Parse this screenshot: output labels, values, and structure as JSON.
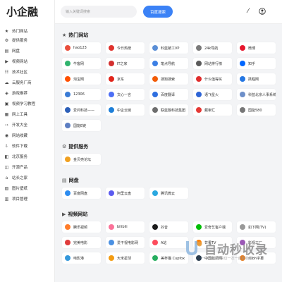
{
  "app": {
    "logo": "小企融"
  },
  "sidebar": {
    "items": [
      {
        "label": "热门网站",
        "icon": "star-icon",
        "glyph": "★"
      },
      {
        "label": "提供服务",
        "icon": "settings-icon",
        "glyph": "⚙"
      },
      {
        "label": "网盘",
        "icon": "drive-icon",
        "glyph": "▤"
      },
      {
        "label": "视频网站",
        "icon": "video-icon",
        "glyph": "▶"
      },
      {
        "label": "技术社区",
        "icon": "community-icon",
        "glyph": "☷"
      },
      {
        "label": "云服务厂商",
        "icon": "cloud-icon",
        "glyph": "☁"
      },
      {
        "label": "游戏推荐",
        "icon": "gamepad-icon",
        "glyph": "◈"
      },
      {
        "label": "视频学习教程",
        "icon": "film-icon",
        "glyph": "▣"
      },
      {
        "label": "网上工具",
        "icon": "tool-icon",
        "glyph": "▦"
      },
      {
        "label": "开发大全",
        "icon": "code-icon",
        "glyph": "‹›"
      },
      {
        "label": "网站收藏",
        "icon": "bookmark-icon",
        "glyph": "◉"
      },
      {
        "label": "软件下载",
        "icon": "download-icon",
        "glyph": "⇩"
      },
      {
        "label": "北京服务",
        "icon": "service-icon",
        "glyph": "◧"
      },
      {
        "label": "开源产品",
        "icon": "package-icon",
        "glyph": "◫"
      },
      {
        "label": "站长之家",
        "icon": "home-icon",
        "glyph": "⌂"
      },
      {
        "label": "图片壁纸",
        "icon": "image-icon",
        "glyph": "▧"
      },
      {
        "label": "项目管理",
        "icon": "project-icon",
        "glyph": "▥"
      }
    ]
  },
  "header": {
    "search_placeholder": "输入关键词搜索",
    "search_button": "百度搜索",
    "theme_icon": "magic-wand-icon",
    "user_icon": "user-icon"
  },
  "sections": [
    {
      "title": "热门网站",
      "icon": "star-icon",
      "glyph": "★",
      "tiles": [
        {
          "label": "hao123",
          "color": "#e94e3c"
        },
        {
          "label": "今日热榜",
          "color": "#e0322d"
        },
        {
          "label": "科蓝破工VP",
          "color": "#5b8fd6"
        },
        {
          "label": "24k导航",
          "color": "#7a7a7a"
        },
        {
          "label": "微博",
          "color": "#e6162d"
        },
        {
          "label": "牛客网",
          "color": "#2fb36d"
        },
        {
          "label": "IT之家",
          "color": "#d32f2f"
        },
        {
          "label": "笔点导航",
          "color": "#3c7fe4"
        },
        {
          "label": "网站排行榜",
          "color": "#5a5a5a"
        },
        {
          "label": "知乎",
          "color": "#0066ff"
        },
        {
          "label": "淘宝网",
          "color": "#ff5000"
        },
        {
          "label": "京东",
          "color": "#e1251b"
        },
        {
          "label": "搜狗搜索",
          "color": "#f25c05"
        },
        {
          "label": "什么值得买",
          "color": "#e02d2d"
        },
        {
          "label": "携程网",
          "color": "#2577e3"
        },
        {
          "label": "12306",
          "color": "#3a7bd5"
        },
        {
          "label": "文心一言",
          "color": "#4c6ef5"
        },
        {
          "label": "百度翻译",
          "color": "#2f6fe0"
        },
        {
          "label": "语飞星火",
          "color": "#2d64d6"
        },
        {
          "label": "科蓝北京人事系统",
          "color": "#6d8fc9"
        },
        {
          "label": "爱问科技——",
          "color": "#2c5fb8"
        },
        {
          "label": "中企云链",
          "color": "#1e7fd8"
        },
        {
          "label": "联蓝融科技集团",
          "color": "#6e6e6e"
        },
        {
          "label": "藏审汇",
          "color": "#e53935"
        },
        {
          "label": "国能580",
          "color": "#777777"
        },
        {
          "label": "国能E链",
          "color": "#5d7ec2"
        }
      ]
    },
    {
      "title": "提供服务",
      "icon": "settings-icon",
      "glyph": "⚙",
      "tiles": [
        {
          "label": "金贝壳论坛",
          "color": "#f0a020"
        }
      ]
    },
    {
      "title": "网盘",
      "icon": "drive-icon",
      "glyph": "▤",
      "tiles": [
        {
          "label": "百度网盘",
          "color": "#2d8cf0"
        },
        {
          "label": "阿里云盘",
          "color": "#5b5bf0"
        },
        {
          "label": "腾讯微云",
          "color": "#2aa8e0"
        }
      ]
    },
    {
      "title": "视频网站",
      "icon": "video-icon",
      "glyph": "▶",
      "tiles": [
        {
          "label": "腾讯视频",
          "color": "#ff7c2a"
        },
        {
          "label": "bilibili",
          "color": "#fb7299"
        },
        {
          "label": "抖音",
          "color": "#1c1c1c"
        },
        {
          "label": "爱奇艺客户端",
          "color": "#00be06"
        },
        {
          "label": "如下网(TV)",
          "color": "#999999"
        },
        {
          "label": "完美电影",
          "color": "#e03b3b"
        },
        {
          "label": "爱干视电影网",
          "color": "#4a90e2"
        },
        {
          "label": "A站",
          "color": "#fd4c5d"
        },
        {
          "label": "芒果TV",
          "color": "#ff7e00"
        },
        {
          "label": "影视工厂",
          "color": "#9b59b6"
        },
        {
          "label": "电影港",
          "color": "#3498db"
        },
        {
          "label": "大米星球",
          "color": "#f39c12"
        },
        {
          "label": "美杯猫 Cupfox",
          "color": "#27ae60"
        },
        {
          "label": "中国蓝调网",
          "color": "#2c3e50"
        },
        {
          "label": "subh字幕",
          "color": "#e67e22"
        }
      ]
    }
  ],
  "watermark": {
    "big": "自动秒收录",
    "small": "一以 链接一来访一次一自助收录一"
  }
}
